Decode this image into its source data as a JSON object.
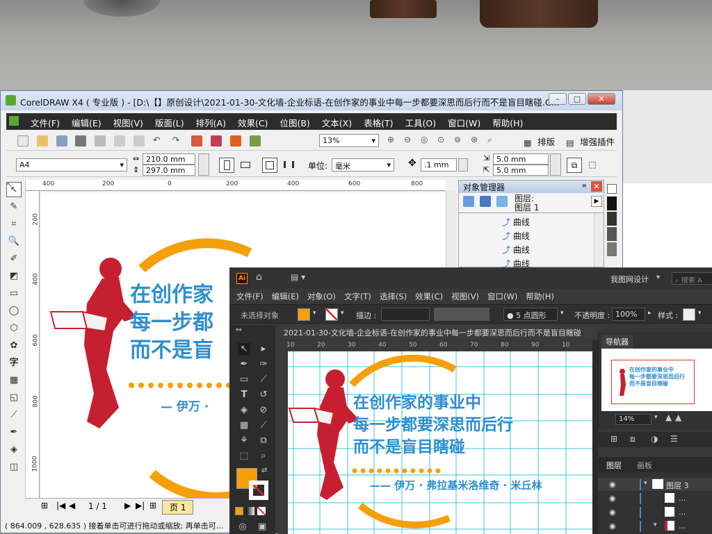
{
  "corel": {
    "title": "CorelDRAW X4 ( 专业版 ) - [D:\\【】原创设计\\2021-01-30-文化墙-企业标语-在创作家的事业中每一步都要深思而后行而不是盲目瞎碰.C...",
    "menu": [
      "文件(F)",
      "编辑(E)",
      "视图(V)",
      "版面(L)",
      "排列(A)",
      "效果(C)",
      "位图(B)",
      "文本(X)",
      "表格(T)",
      "工具(O)",
      "窗口(W)",
      "帮助(H)"
    ],
    "zoom": "13%",
    "paper": "A4",
    "width": "210.0 mm",
    "height": "297.0 mm",
    "unit_label": "单位:",
    "unit_value": "毫米",
    "nudge": ".1 mm",
    "dup_x": "5.0 mm",
    "dup_y": "5.0 mm",
    "btn_layout": "排版",
    "btn_plugin": "增强插件",
    "ruler_top": [
      "400",
      "200",
      "0",
      "200",
      "400",
      "600",
      "800"
    ],
    "ruler_left": [
      "200",
      "400",
      "600",
      "800",
      "1000"
    ],
    "page_counter": "1 / 1",
    "page_tab": "页 1",
    "status": "( 864.009 , 628.635 )   接着单击可进行拖动或缩放; 再单击可...",
    "obj_manager": {
      "title": "对象管理器",
      "layer_label": "图层:",
      "layer_name": "图层 1",
      "items": [
        "曲线",
        "曲线",
        "曲线",
        "曲线"
      ]
    }
  },
  "artwork": {
    "lines": [
      "在创作家的事业中",
      "每一步都要深思而后行",
      "而不是盲目瞎碰"
    ],
    "corel_lines": [
      "在创作家",
      "每一步都",
      "而不是盲"
    ],
    "corel_author": "— 伊万 ·",
    "author": "—— 伊万 · 弗拉基米洛维奇 · 米丘林"
  },
  "ai": {
    "logo": "Ai",
    "workspace": "我图网设计",
    "search_placeholder": "搜索 A",
    "menu": [
      "文件(F)",
      "编辑(E)",
      "对象(O)",
      "文字(T)",
      "选择(S)",
      "效果(C)",
      "视图(V)",
      "窗口(W)",
      "帮助(H)"
    ],
    "no_selection": "未选择对象",
    "stroke_label": "描边 :",
    "brush": "5 点圆形",
    "opacity_label": "不透明度 :",
    "opacity": "100%",
    "style_label": "样式 :",
    "doc_tab": "2021-01-30-文化墙-企业标语-在创作家的事业中每一步都要深思而后行而不是盲目瞎碰",
    "ruler": [
      "10",
      "20",
      "30",
      "40",
      "50",
      "60",
      "70",
      "80",
      "90",
      "10"
    ],
    "navigator_title": "导航器",
    "nav_zoom": "14%",
    "layers_tab": "图层",
    "artboards_tab": "画板",
    "layer_name": "图层 3",
    "sublayers": [
      "...",
      "...",
      "..."
    ]
  },
  "colors": {
    "corel_menu_bg": "#2c2c2c",
    "ai_bg": "#383838",
    "red": "#c62030",
    "blue": "#2e8ed1",
    "orange": "#f5a00a"
  }
}
